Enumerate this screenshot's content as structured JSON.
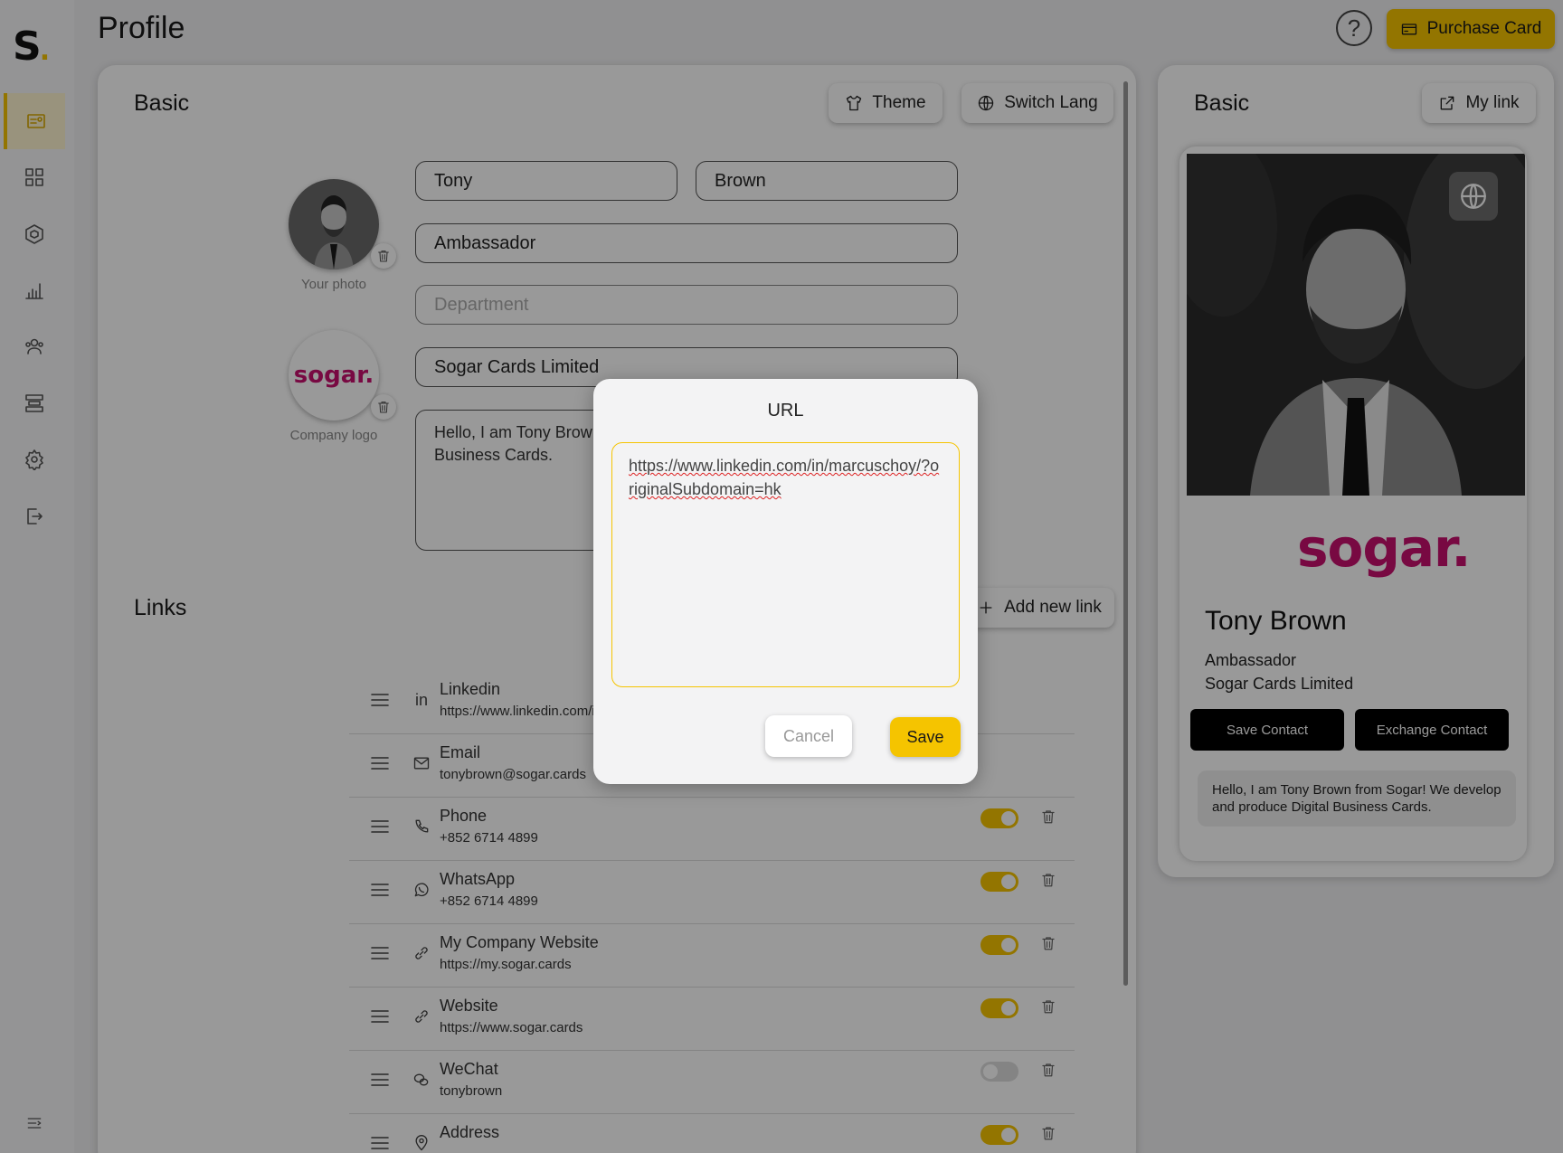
{
  "app": {
    "logo_text": "S",
    "logo_dot": "."
  },
  "header": {
    "title": "Profile",
    "help_label": "?",
    "purchase_label": "Purchase Card"
  },
  "sidebar": {
    "items": [
      {
        "name": "profile",
        "icon": "profile-card-icon",
        "active": true
      },
      {
        "name": "dashboard",
        "icon": "grid-icon"
      },
      {
        "name": "products",
        "icon": "hexagon-icon"
      },
      {
        "name": "analytics",
        "icon": "bar-chart-icon"
      },
      {
        "name": "contacts",
        "icon": "users-icon"
      },
      {
        "name": "layouts",
        "icon": "layout-icon"
      },
      {
        "name": "settings",
        "icon": "gear-icon"
      },
      {
        "name": "logout",
        "icon": "logout-icon"
      }
    ],
    "collapse_icon": "collapse-menu-icon"
  },
  "basic": {
    "title": "Basic",
    "theme_label": "Theme",
    "switch_lang_label": "Switch Lang",
    "first_name": "Tony",
    "last_name": "Brown",
    "job_title": "Ambassador",
    "department_placeholder": "Department",
    "company": "Sogar Cards Limited",
    "bio": "Hello, I am Tony Brown from Sogar! We develop and produce Digital Business Cards.",
    "photo_label": "Your photo",
    "logo_label": "Company logo",
    "company_logo_text": "sogar."
  },
  "links": {
    "title": "Links",
    "add_label": "Add new link",
    "items": [
      {
        "name": "Linkedin",
        "value": "https://www.linkedin.com/in/marcuschoy/?originalSubdomain=hk",
        "icon": "linkedin-icon",
        "enabled": true
      },
      {
        "name": "Email",
        "value": "tonybrown@sogar.cards",
        "icon": "mail-icon",
        "enabled": true
      },
      {
        "name": "Phone",
        "value": "+852 6714 4899",
        "icon": "phone-icon",
        "enabled": true
      },
      {
        "name": "WhatsApp",
        "value": "+852 6714 4899",
        "icon": "whatsapp-icon",
        "enabled": true
      },
      {
        "name": "My Company Website",
        "value": "https://my.sogar.cards",
        "icon": "link-icon",
        "enabled": true
      },
      {
        "name": "Website",
        "value": "https://www.sogar.cards",
        "icon": "link-icon",
        "enabled": true
      },
      {
        "name": "WeChat",
        "value": "tonybrown",
        "icon": "wechat-icon",
        "enabled": false
      },
      {
        "name": "Address",
        "value": "",
        "icon": "location-icon",
        "enabled": true
      }
    ]
  },
  "preview": {
    "title": "Basic",
    "my_link_label": "My link",
    "brand": "sogar.",
    "name": "Tony Brown",
    "role": "Ambassador",
    "company": "Sogar Cards Limited",
    "save_contact": "Save Contact",
    "exchange_contact": "Exchange Contact",
    "bio": "Hello, I am Tony Brown from Sogar! We develop and produce Digital Business Cards."
  },
  "modal": {
    "title": "URL",
    "value": "https://www.linkedin.com/in/marcuschoy/?originalSubdomain=hk",
    "cancel_label": "Cancel",
    "save_label": "Save"
  },
  "colors": {
    "accent": "#f5c400",
    "brand": "#c8106e",
    "overlay": "rgba(0,0,0,0.4)"
  }
}
